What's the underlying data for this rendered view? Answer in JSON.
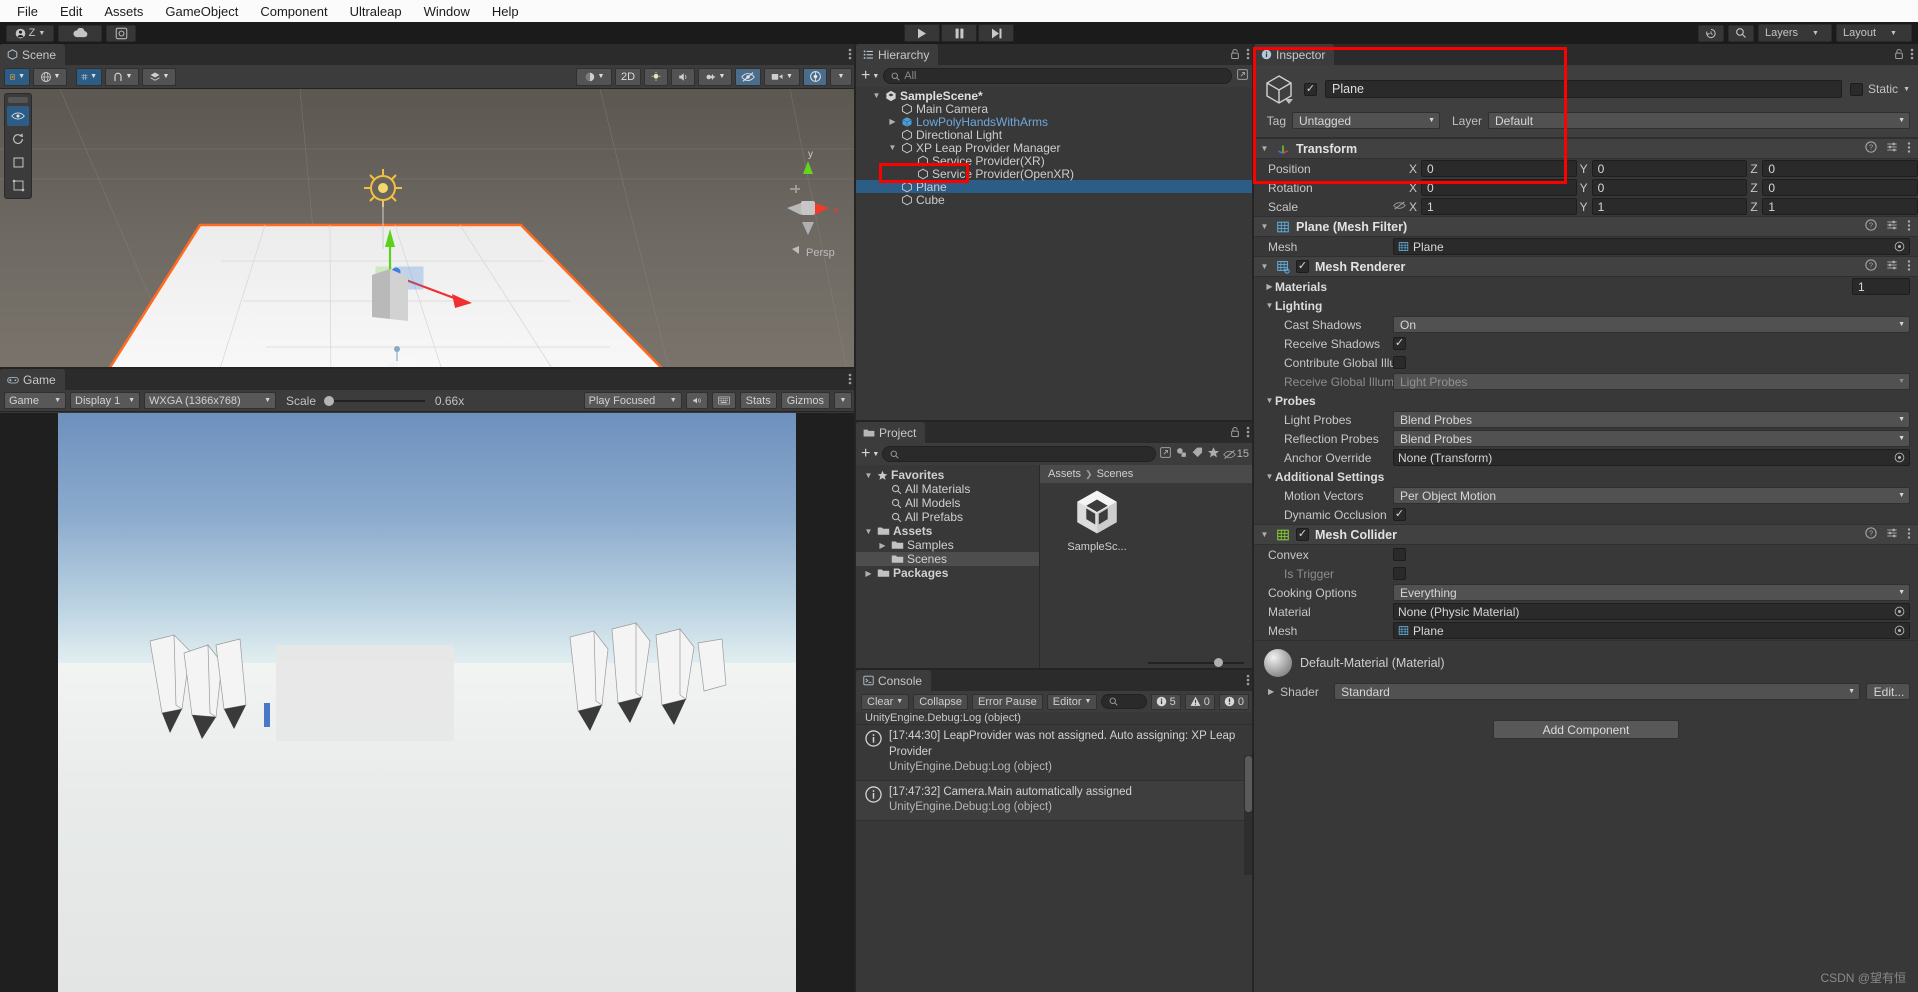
{
  "menubar": {
    "items": [
      "File",
      "Edit",
      "Assets",
      "GameObject",
      "Component",
      "Ultraleap",
      "Window",
      "Help"
    ]
  },
  "toolbar": {
    "account_label": "Z",
    "cloud_icon": "cloud-icon",
    "services_icon": "services-icon",
    "play_icon": "play-icon",
    "pause_icon": "pause-icon",
    "step_icon": "step-icon",
    "undo_icon": "undo-history-icon",
    "search_icon": "search-icon",
    "layers_label": "Layers",
    "layout_label": "Layout"
  },
  "scene": {
    "tab": "Scene",
    "tools": {
      "hand": "hand-tool-icon",
      "move": "move-tool-icon",
      "rotate": "rotate-tool-icon",
      "scale": "scale-tool-icon",
      "rect": "rect-tool-icon",
      "transform": "transform-tool-icon",
      "pivot": "pivot-toggle",
      "local": "local-global-toggle",
      "grid": "grid-icon",
      "two_d": "2D",
      "lighting": "lighting-icon",
      "audio": "audio-icon",
      "fx": "effects-icon",
      "visibility": "scene-visibility-icon",
      "camera": "scene-camera-icon",
      "gizmos": "gizmos-icon"
    },
    "gizmo": {
      "x": "x",
      "y": "y",
      "persp": "Persp"
    }
  },
  "game": {
    "tab": "Game",
    "tab2": "Game",
    "display": "Display 1",
    "resolution": "WXGA (1366x768)",
    "scale_label": "Scale",
    "scale_value": "0.66x",
    "play_focused": "Play Focused",
    "mute_icon": "mute-audio-icon",
    "stats_label": "Stats",
    "gizmos_label": "Gizmos"
  },
  "hierarchy": {
    "tab": "Hierarchy",
    "search_placeholder": "All",
    "add_label": "+",
    "items": [
      {
        "label": "SampleScene*",
        "indent": 0,
        "icon": "unity-scene-icon",
        "arrow": "down",
        "style": "bold"
      },
      {
        "label": "Main Camera",
        "indent": 1,
        "icon": "gameobject-icon",
        "arrow": "none",
        "style": "normal"
      },
      {
        "label": "LowPolyHandsWithArms",
        "indent": 1,
        "icon": "prefab-icon",
        "arrow": "right",
        "style": "prefab"
      },
      {
        "label": "Directional Light",
        "indent": 1,
        "icon": "gameobject-icon",
        "arrow": "none",
        "style": "normal"
      },
      {
        "label": "XP Leap Provider Manager",
        "indent": 1,
        "icon": "gameobject-icon",
        "arrow": "down",
        "style": "normal"
      },
      {
        "label": "Service Provider(XR)",
        "indent": 2,
        "icon": "gameobject-icon",
        "arrow": "none",
        "style": "normal"
      },
      {
        "label": "Service Provider(OpenXR)",
        "indent": 2,
        "icon": "gameobject-icon",
        "arrow": "none",
        "style": "normal"
      },
      {
        "label": "Plane",
        "indent": 1,
        "icon": "gameobject-icon",
        "arrow": "none",
        "style": "normal",
        "selected": true
      },
      {
        "label": "Cube",
        "indent": 1,
        "icon": "gameobject-icon",
        "arrow": "none",
        "style": "normal"
      }
    ]
  },
  "project": {
    "tab": "Project",
    "search_placeholder": "",
    "hidden_count": "15",
    "breadcrumb": [
      "Assets",
      "Scenes"
    ],
    "tree": [
      {
        "label": "Favorites",
        "indent": 0,
        "icon": "star-icon",
        "arrow": "down",
        "bold": true
      },
      {
        "label": "All Materials",
        "indent": 1,
        "icon": "search-icon",
        "arrow": "none",
        "bold": false
      },
      {
        "label": "All Models",
        "indent": 1,
        "icon": "search-icon",
        "arrow": "none",
        "bold": false
      },
      {
        "label": "All Prefabs",
        "indent": 1,
        "icon": "search-icon",
        "arrow": "none",
        "bold": false
      },
      {
        "label": "Assets",
        "indent": 0,
        "icon": "folder-icon",
        "arrow": "down",
        "bold": true
      },
      {
        "label": "Samples",
        "indent": 1,
        "icon": "folder-icon",
        "arrow": "right",
        "bold": false
      },
      {
        "label": "Scenes",
        "indent": 1,
        "icon": "folder-icon",
        "arrow": "none",
        "bold": false,
        "selected": true
      },
      {
        "label": "Packages",
        "indent": 0,
        "icon": "folder-icon",
        "arrow": "right",
        "bold": true
      }
    ],
    "assets": [
      {
        "label": "SampleSc...",
        "icon": "unity-scene-asset-icon"
      }
    ]
  },
  "console": {
    "tab": "Console",
    "clear_label": "Clear",
    "collapse_label": "Collapse",
    "error_pause_label": "Error Pause",
    "editor_label": "Editor",
    "search_placeholder": "",
    "counts": {
      "info": "5",
      "warning": "0",
      "error": "0"
    },
    "messages": [
      {
        "line1": "[17:44:30] LeapProvider was not assigned. Auto assigning: XP Leap Provider",
        "line2": "UnityEngine.Debug:Log (object)",
        "type": "info"
      },
      {
        "line1": "[17:47:32] Camera.Main automatically assigned",
        "line2": "UnityEngine.Debug:Log (object)",
        "type": "info"
      }
    ],
    "top_snippet": "UnityEngine.Debug:Log (object)"
  },
  "inspector": {
    "tab": "Inspector",
    "object_name": "Plane",
    "enabled": true,
    "static_label": "Static",
    "static_checked": false,
    "tag_label": "Tag",
    "tag_value": "Untagged",
    "layer_label": "Layer",
    "layer_value": "Default",
    "components": [
      {
        "name": "Transform",
        "icon": "transform-icon",
        "has_checkbox": false,
        "rows": [
          {
            "type": "vector3",
            "label": "Position",
            "x": "0",
            "y": "0",
            "z": "0"
          },
          {
            "type": "vector3",
            "label": "Rotation",
            "x": "0",
            "y": "0",
            "z": "0"
          },
          {
            "type": "vector3",
            "label": "Scale",
            "x": "1",
            "y": "1",
            "z": "1",
            "has_link_icon": true
          }
        ]
      },
      {
        "name": "Plane (Mesh Filter)",
        "icon": "mesh-filter-icon",
        "has_checkbox": false,
        "rows": [
          {
            "type": "object",
            "label": "Mesh",
            "value": "Plane",
            "value_icon": "mesh-icon"
          }
        ]
      },
      {
        "name": "Mesh Renderer",
        "icon": "mesh-renderer-icon",
        "has_checkbox": true,
        "checked": true,
        "rows": [
          {
            "type": "foldout-count",
            "label": "Materials",
            "value": "1",
            "arrow": "right"
          },
          {
            "type": "foldout",
            "label": "Lighting",
            "arrow": "down"
          },
          {
            "type": "dropdown",
            "label": "Cast Shadows",
            "value": "On",
            "indent": 2
          },
          {
            "type": "checkbox",
            "label": "Receive Shadows",
            "checked": true,
            "indent": 2
          },
          {
            "type": "checkbox",
            "label": "Contribute Global Illu",
            "checked": false,
            "indent": 2
          },
          {
            "type": "dropdown",
            "label": "Receive Global Illumi",
            "value": "Light Probes",
            "indent": 2,
            "disabled": true
          },
          {
            "type": "foldout",
            "label": "Probes",
            "arrow": "down"
          },
          {
            "type": "dropdown",
            "label": "Light Probes",
            "value": "Blend Probes",
            "indent": 2
          },
          {
            "type": "dropdown",
            "label": "Reflection Probes",
            "value": "Blend Probes",
            "indent": 2
          },
          {
            "type": "object",
            "label": "Anchor Override",
            "value": "None (Transform)",
            "indent": 2
          },
          {
            "type": "foldout",
            "label": "Additional Settings",
            "arrow": "down"
          },
          {
            "type": "dropdown",
            "label": "Motion Vectors",
            "value": "Per Object Motion",
            "indent": 2
          },
          {
            "type": "checkbox",
            "label": "Dynamic Occlusion",
            "checked": true,
            "indent": 2
          }
        ]
      },
      {
        "name": "Mesh Collider",
        "icon": "mesh-collider-icon",
        "has_checkbox": true,
        "checked": true,
        "rows": [
          {
            "type": "checkbox",
            "label": "Convex",
            "checked": false
          },
          {
            "type": "checkbox",
            "label": "Is Trigger",
            "checked": false,
            "indent": 2,
            "disabled": true
          },
          {
            "type": "dropdown",
            "label": "Cooking Options",
            "value": "Everything"
          },
          {
            "type": "object",
            "label": "Material",
            "value": "None (Physic Material)"
          },
          {
            "type": "object",
            "label": "Mesh",
            "value": "Plane",
            "value_icon": "mesh-icon"
          }
        ]
      }
    ],
    "material": {
      "title": "Default-Material (Material)",
      "shader_label": "Shader",
      "shader_value": "Standard",
      "edit_label": "Edit..."
    },
    "add_component_label": "Add Component"
  },
  "watermark": "CSDN @望有恒",
  "colors": {
    "accent_selected": "#2c5d87",
    "annotation": "#fe0000",
    "prefab_blue": "#6fa8dc",
    "panel_bg": "#383838",
    "toolbar_bg": "#3c3c3c"
  }
}
